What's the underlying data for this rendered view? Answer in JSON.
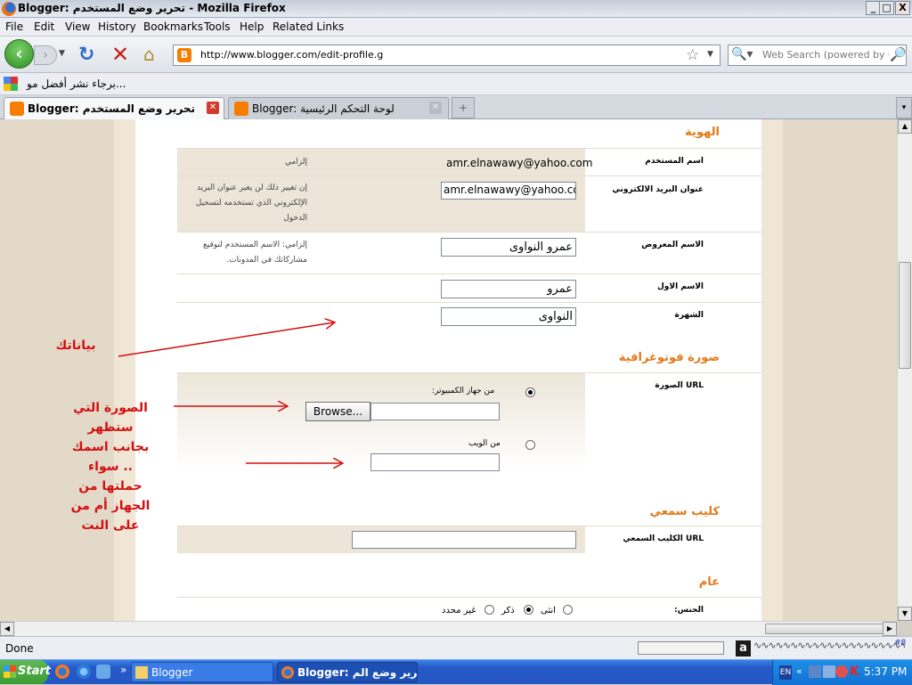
{
  "window": {
    "title": "Blogger: تحرير وضع المستخدم - Mozilla Firefox",
    "btn_min": "_",
    "btn_max": "□",
    "btn_close": "X"
  },
  "menu": [
    "File",
    "Edit",
    "View",
    "History",
    "Bookmarks",
    "Tools",
    "Help",
    "Related Links"
  ],
  "nav": {
    "url": "http://www.blogger.com/edit-profile.g",
    "search_placeholder": "Web Search (powered by Goo"
  },
  "bookmarks": {
    "item": "برجاء نشر أفضل مو..."
  },
  "tabs": [
    {
      "label": "Blogger: تحرير وضع المستخدم",
      "active": true
    },
    {
      "label": "Blogger: لوحة التحكم الرئيسية",
      "active": false
    }
  ],
  "tabs_extra": {
    "new_tab": "+",
    "list": "▾"
  },
  "sections": {
    "identity": "الهوية",
    "photo": "صورة فوتوغرافية",
    "audio": "كليب سمعي",
    "general": "عام"
  },
  "form": {
    "username": {
      "label": "اسم المستخدم",
      "value": "amr.elnawawy@yahoo.com",
      "note": "إلزامي"
    },
    "email": {
      "label": "عنوان البريد الالكتروني",
      "value": "amr.elnawawy@yahoo.com",
      "note": "إن تغيير ذلك لن يغير عنوان البريد الإلكتروني الذي تستخدمه لتسجيل الدخول"
    },
    "display_name": {
      "label": "الاسم المعروض",
      "value": "عمرو النواوى",
      "note": "إلزامي: الاسم المستخدم لتوقيع مشاركاتك في المدونات."
    },
    "first_name": {
      "label": "الاسم الاول",
      "value": "عمرو"
    },
    "last_name": {
      "label": "الشهرة",
      "value": "النواوى"
    },
    "photo_url": {
      "label": "URL الصورة",
      "from_computer": "من جهاز الكمبيوتر:",
      "browse": "Browse...",
      "from_web": "من الويب"
    },
    "audio_url": {
      "label": "URL الكليب السمعي"
    },
    "gender": {
      "label": "الجنس:",
      "female": "انثى",
      "male": "ذكر",
      "unspecified": "غير محدد"
    }
  },
  "annotations": {
    "data": "بياناتك",
    "photo": "الصورة التي ستظهر بجانب اسمك .. سواء حملتها من الجهاز أم من على النت"
  },
  "status": {
    "text": "Done",
    "page_num": "#8"
  },
  "taskbar": {
    "start": "Start",
    "task1": "Blogger",
    "task2": "Blogger: تحرير وضع الم...",
    "clock": "5:37 PM",
    "lang": "EN",
    "more": "»"
  }
}
